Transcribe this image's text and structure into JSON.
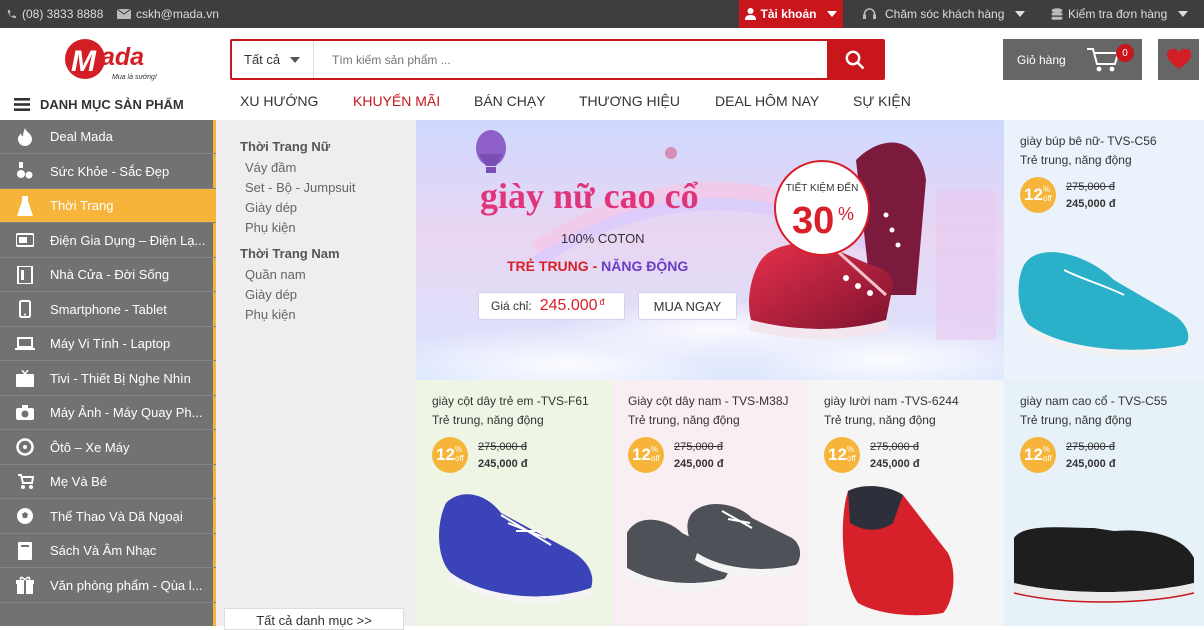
{
  "topbar": {
    "phone": "(08) 3833 8888",
    "email": "cskh@mada.vn",
    "account": "Tài khoản",
    "support": "Chăm sóc khách hàng",
    "order": "Kiểm tra đơn hàng"
  },
  "logo": {
    "text": "Mada",
    "slogan": "Mua là sướng!"
  },
  "search": {
    "category": "Tất cả",
    "placeholder": "Tìm kiếm sản phẩm ..."
  },
  "cart": {
    "label": "Giỏ hàng",
    "count": "0"
  },
  "categories_header": "DANH MỤC SẢN PHẨM",
  "nav": [
    "XU HƯỚNG",
    "KHUYẾN MÃI",
    "BÁN CHẠY",
    "THƯƠNG HIỆU",
    "DEAL HÔM NAY",
    "SỰ KIỆN"
  ],
  "sidebar": [
    {
      "label": "Deal Mada",
      "icon": "fire-icon"
    },
    {
      "label": "Sức Khỏe - Sắc Đẹp",
      "icon": "cosmetics-icon"
    },
    {
      "label": "Thời Trang",
      "icon": "dress-icon"
    },
    {
      "label": "Điện Gia Dụng – Điện Lạ...",
      "icon": "appliance-icon"
    },
    {
      "label": "Nhà Cửa - Đời Sống",
      "icon": "home-icon"
    },
    {
      "label": "Smartphone - Tablet",
      "icon": "smartphone-icon"
    },
    {
      "label": "Máy Vi Tính - Laptop",
      "icon": "laptop-icon"
    },
    {
      "label": "Tivi - Thiết Bị Nghe Nhìn",
      "icon": "tv-icon"
    },
    {
      "label": "Máy Ảnh - Máy Quay Ph...",
      "icon": "camera-icon"
    },
    {
      "label": "Ôtô – Xe Máy",
      "icon": "car-icon"
    },
    {
      "label": "Mẹ Và Bé",
      "icon": "stroller-icon"
    },
    {
      "label": "Thể Thao Và Dã Ngoại",
      "icon": "ball-icon"
    },
    {
      "label": "Sách Và Âm Nhạc",
      "icon": "book-icon"
    },
    {
      "label": "Văn phòng phẩm - Qùa l...",
      "icon": "gift-icon"
    }
  ],
  "submenu": {
    "women": {
      "title": "Thời Trang Nữ",
      "items": [
        "Váy đầm",
        "Set - Bộ - Jumpsuit",
        "Giày dép",
        "Phụ kiện"
      ]
    },
    "men": {
      "title": "Thời Trang Nam",
      "items": [
        "Quần nam",
        "Giày dép",
        "Phụ kiện"
      ]
    },
    "all": "Tất cả danh mục >>"
  },
  "banner": {
    "title": "giày nữ cao cổ",
    "material": "100% COTON",
    "tagline_1": "TRẺ TRUNG",
    "tagline_dash": " - ",
    "tagline_2": "NĂNG ĐỘNG",
    "price_label": "Giá chỉ:",
    "price": "245.000",
    "currency": "đ",
    "buy": "MUA NGAY",
    "save_label": "TIẾT KIỆM ĐẾN",
    "save_value": "30",
    "save_pct": "%"
  },
  "products": [
    {
      "name": "giày búp bê nữ- TVS-C56",
      "desc": "Trẻ trung, năng động",
      "discount": "12",
      "old_price": "275,000 đ",
      "new_price": "245,000 đ",
      "bg": "#eaf2fb",
      "shoe": "#2ab0c9"
    },
    {
      "name": "giày cột dây trẻ em -TVS-F61",
      "desc": "Trẻ trung, năng động",
      "discount": "12",
      "old_price": "275,000 đ",
      "new_price": "245,000 đ",
      "bg": "#eef5e4",
      "shoe": "#3b43b8"
    },
    {
      "name": "Giày cột dây nam - TVS-M38J",
      "desc": "Trẻ trung, năng động",
      "discount": "12",
      "old_price": "275,000 đ",
      "new_price": "245,000 đ",
      "bg": "#f9eef1",
      "shoe": "#4f5158"
    },
    {
      "name": "giày lười nam -TVS-6244",
      "desc": "Trẻ trung, năng động",
      "discount": "12",
      "old_price": "275,000 đ",
      "new_price": "245,000 đ",
      "bg": "#f5f5f5",
      "shoe": "#d6202a"
    },
    {
      "name": "giày nam cao cổ - TVS-C55",
      "desc": "Trẻ trung, năng động",
      "discount": "12",
      "old_price": "275,000 đ",
      "new_price": "245,000 đ",
      "bg": "#e6f2f7",
      "shoe": "#1e1e1e"
    }
  ],
  "discount_unit": "%",
  "discount_off": "off",
  "colors": {
    "brand_red": "#c9161d",
    "accent_yellow": "#f6b53a",
    "sidebar_gray": "#727272",
    "topbar": "#3e3e3e"
  }
}
